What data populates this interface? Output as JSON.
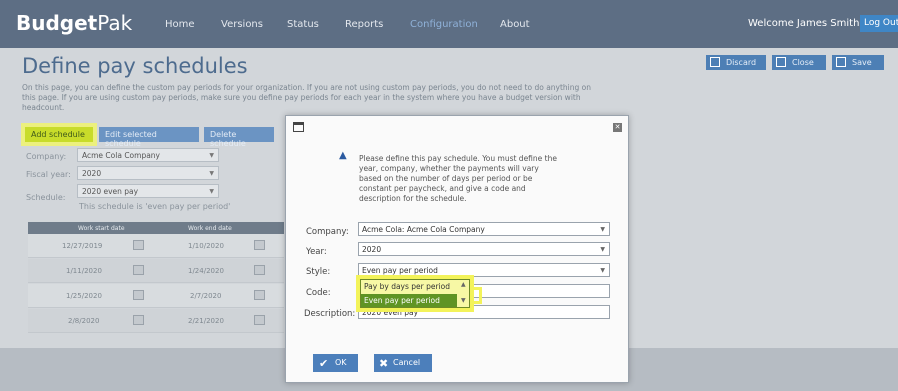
{
  "app": {
    "logo_bold": "Budget",
    "logo_light": "Pak"
  },
  "nav": {
    "items": [
      "Home",
      "Versions",
      "Status",
      "Reports",
      "Configuration",
      "About"
    ],
    "active": "Configuration"
  },
  "user": {
    "welcome": "Welcome James Smith!",
    "logout": "Log Out"
  },
  "page": {
    "title": "Define pay schedules",
    "description": "On this page, you can define the custom pay periods for your organization. If you are not using custom pay periods, you do not need to do anything on this page. If you are using custom pay periods, make sure you define pay periods for each year in the system where you have a budget version with headcount."
  },
  "top_buttons": {
    "discard": "Discard",
    "close": "Close",
    "save": "Save"
  },
  "actions": {
    "add": "Add schedule",
    "edit": "Edit selected schedule",
    "delete": "Delete schedule"
  },
  "filters": {
    "company_label": "Company:",
    "company_value": "Acme Cola Company",
    "year_label": "Fiscal year:",
    "year_value": "2020",
    "schedule_label": "Schedule:",
    "schedule_value": "2020 even pay",
    "note": "This schedule is 'even pay per period'"
  },
  "table": {
    "headers": [
      "Work start date",
      "Work end date"
    ],
    "rows": [
      [
        "12/27/2019",
        "1/10/2020"
      ],
      [
        "1/11/2020",
        "1/24/2020"
      ],
      [
        "1/25/2020",
        "2/7/2020"
      ],
      [
        "2/8/2020",
        "2/21/2020"
      ]
    ]
  },
  "modal": {
    "message": "Please define this pay schedule. You must define the year, company, whether the payments will vary based on the number of days per period or be constant per paycheck, and give a code and description for the schedule.",
    "company_label": "Company:",
    "company_value": "Acme Cola: Acme Cola Company",
    "year_label": "Year:",
    "year_value": "2020",
    "style_label": "Style:",
    "style_value": "Even pay per period",
    "code_label": "Code:",
    "code_value": "",
    "description_label": "Description:",
    "description_value": "2020 even pay",
    "style_options": [
      "Pay by days per period",
      "Even pay per period"
    ],
    "ok": "OK",
    "cancel": "Cancel"
  },
  "colors": {
    "nav_bg": "#5d6e84",
    "accent_blue": "#4c7fbb",
    "highlight_yellow": "#f3f35a",
    "selected_green": "#5f9424"
  }
}
